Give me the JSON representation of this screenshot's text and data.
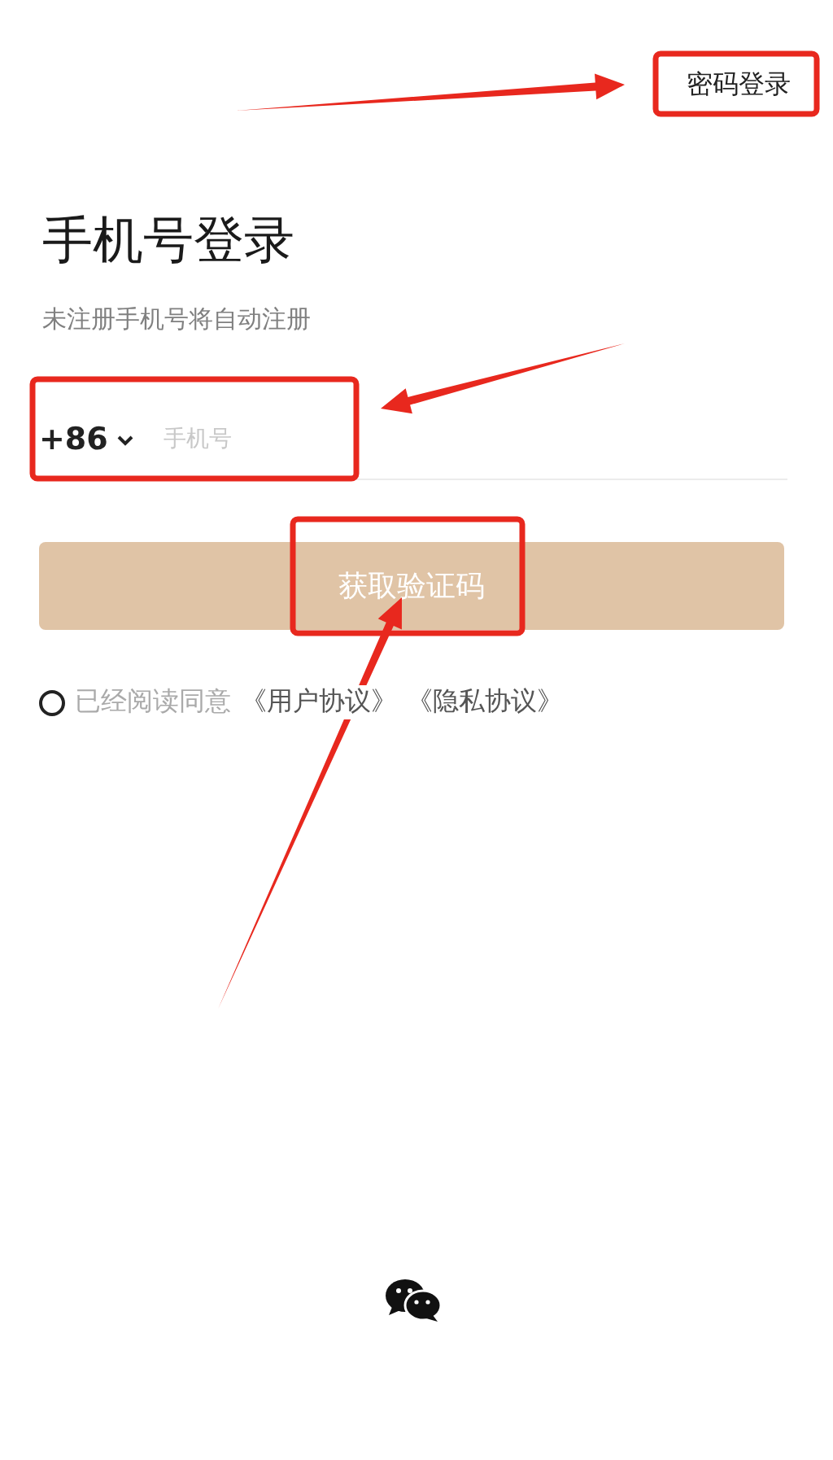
{
  "header": {
    "switch_link": "密码登录"
  },
  "title": "手机号登录",
  "subtitle": "未注册手机号将自动注册",
  "phone": {
    "country_code": "+86",
    "placeholder": "手机号"
  },
  "submit": {
    "label": "获取验证码",
    "disabled": true
  },
  "agreement": {
    "checked": false,
    "text": "已经阅读同意",
    "links": [
      "《用户协议》",
      "《隐私协议》"
    ]
  },
  "annotations": [
    {
      "kind": "box"
    },
    {
      "kind": "box"
    },
    {
      "kind": "box"
    },
    {
      "kind": "arrow"
    },
    {
      "kind": "arrow"
    },
    {
      "kind": "arrow"
    }
  ]
}
